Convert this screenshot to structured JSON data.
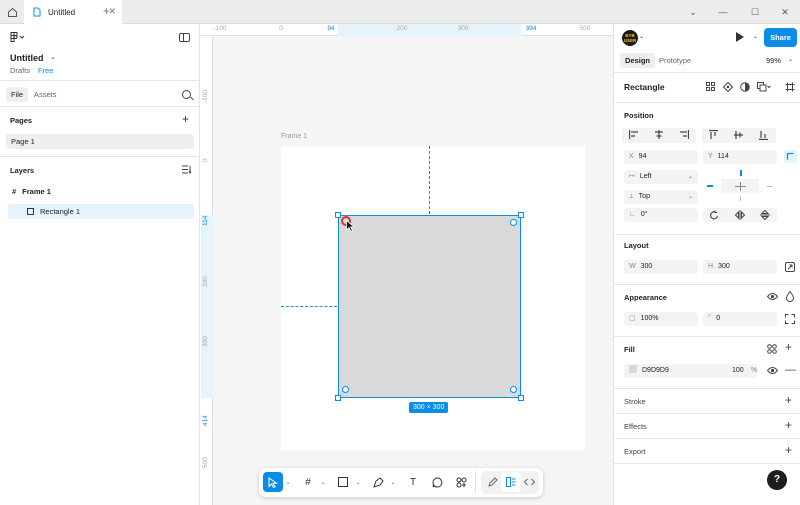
{
  "tabbar": {
    "tab_title": "Untitled",
    "close_glyph": "✕",
    "new_tab_glyph": "+",
    "window_controls": [
      "⌄",
      "—",
      "☐",
      "✕"
    ]
  },
  "left_panel": {
    "file_title": "Untitled",
    "file_chevron": "⌄",
    "drafts_label": "Drafts",
    "plan_label": "Free",
    "tabs": {
      "file": "File",
      "assets": "Assets"
    },
    "pages_heading": "Pages",
    "pages": [
      "Page 1"
    ],
    "layers_heading": "Layers",
    "layers": [
      {
        "name": "Frame 1",
        "icon": "frame-icon"
      },
      {
        "name": "Rectangle 1",
        "icon": "rectangle-icon"
      }
    ]
  },
  "canvas": {
    "ruler_top": [
      {
        "label": "-100",
        "highlight": false
      },
      {
        "label": "0",
        "highlight": false
      },
      {
        "label": "94",
        "highlight": true
      },
      {
        "label": "200",
        "highlight": false
      },
      {
        "label": "300",
        "highlight": false
      },
      {
        "label": "394",
        "highlight": true
      },
      {
        "label": "500",
        "highlight": false
      }
    ],
    "ruler_left": [
      {
        "label": "-100",
        "highlight": false
      },
      {
        "label": "0",
        "highlight": false
      },
      {
        "label": "114",
        "highlight": true
      },
      {
        "label": "200",
        "highlight": false
      },
      {
        "label": "300",
        "highlight": false
      },
      {
        "label": "414",
        "highlight": true
      },
      {
        "label": "500",
        "highlight": false
      }
    ],
    "frame_label": "Frame 1",
    "selection_size": "300 × 300",
    "accent_color": "#0c8ce9",
    "rect_fill": "#d9d9d9"
  },
  "toolbar": {
    "tools": [
      "move-tool",
      "frame-tool",
      "shape-tool",
      "pen-tool",
      "text-tool",
      "comment-tool",
      "actions-tool"
    ],
    "text_glyph": "T"
  },
  "right_panel": {
    "avatar_text": "BYB\nUSER",
    "share_label": "Share",
    "tabs": {
      "design": "Design",
      "prototype": "Prototype"
    },
    "zoom": "99%",
    "selection_name": "Rectangle",
    "position": {
      "heading": "Position",
      "x_label": "X",
      "x_value": "94",
      "y_label": "Y",
      "y_value": "114",
      "h_constraint": "Left",
      "v_constraint": "Top",
      "rotation": "0°"
    },
    "layout": {
      "heading": "Layout",
      "w_label": "W",
      "w_value": "300",
      "h_label": "H",
      "h_value": "300"
    },
    "appearance": {
      "heading": "Appearance",
      "opacity": "100%",
      "radius": "0"
    },
    "fill": {
      "heading": "Fill",
      "hex": "D9D9D9",
      "opacity": "100",
      "percent": "%"
    },
    "stroke_heading": "Stroke",
    "effects_heading": "Effects",
    "export_heading": "Export",
    "help_glyph": "?"
  }
}
